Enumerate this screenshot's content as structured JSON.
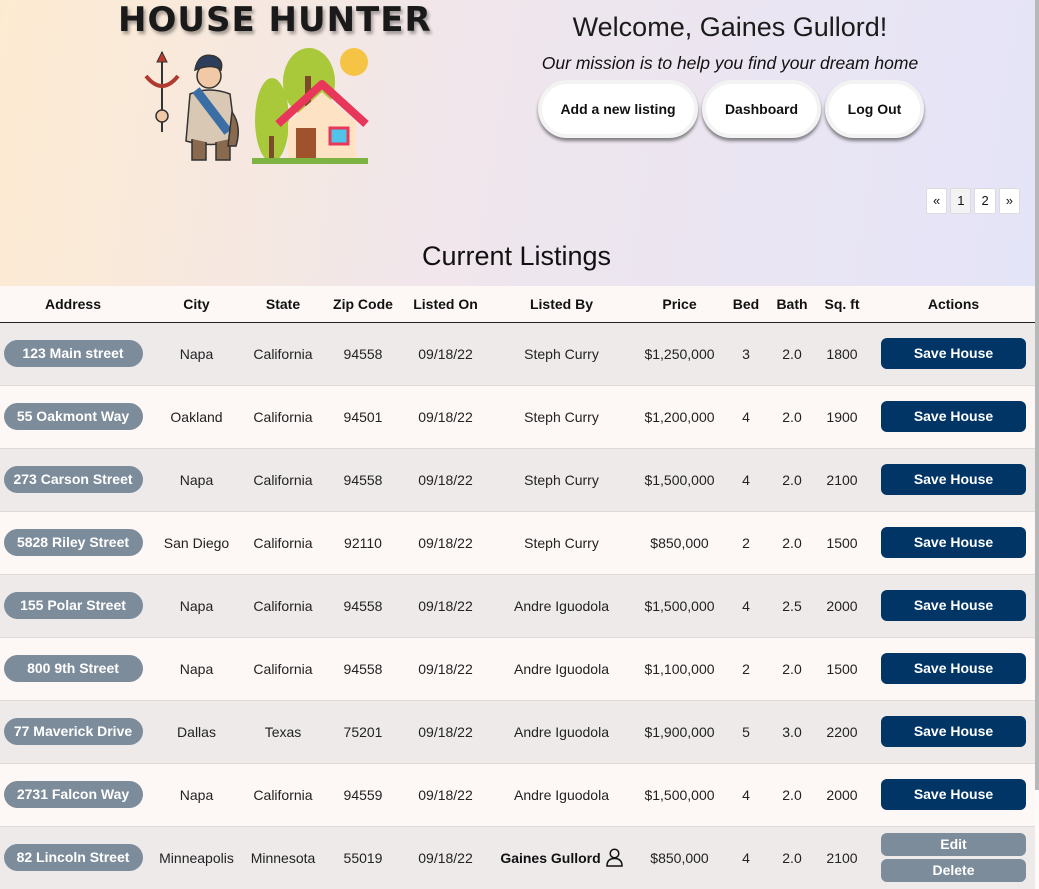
{
  "brand": {
    "title": "HOUSE HUNTER"
  },
  "header": {
    "welcome": "Welcome, Gaines Gullord!",
    "mission": "Our mission is to help you find your dream home",
    "add_listing_label": "Add a new listing",
    "dashboard_label": "Dashboard",
    "logout_label": "Log Out"
  },
  "pagination": {
    "prev": "«",
    "page1": "1",
    "page2": "2",
    "next": "»"
  },
  "listings": {
    "title": "Current Listings",
    "columns": [
      "Address",
      "City",
      "State",
      "Zip Code",
      "Listed On",
      "Listed By",
      "Price",
      "Bed",
      "Bath",
      "Sq. ft",
      "Actions"
    ],
    "save_label": "Save House",
    "edit_label": "Edit",
    "delete_label": "Delete",
    "rows": [
      {
        "address": "123 Main street",
        "city": "Napa",
        "state": "California",
        "zip": "94558",
        "listed_on": "09/18/22",
        "listed_by": "Steph Curry",
        "price": "$1,250,000",
        "bed": "3",
        "bath": "2.0",
        "sqft": "1800"
      },
      {
        "address": "55 Oakmont Way",
        "city": "Oakland",
        "state": "California",
        "zip": "94501",
        "listed_on": "09/18/22",
        "listed_by": "Steph Curry",
        "price": "$1,200,000",
        "bed": "4",
        "bath": "2.0",
        "sqft": "1900"
      },
      {
        "address": "273 Carson Street",
        "city": "Napa",
        "state": "California",
        "zip": "94558",
        "listed_on": "09/18/22",
        "listed_by": "Steph Curry",
        "price": "$1,500,000",
        "bed": "4",
        "bath": "2.0",
        "sqft": "2100"
      },
      {
        "address": "5828 Riley Street",
        "city": "San Diego",
        "state": "California",
        "zip": "92110",
        "listed_on": "09/18/22",
        "listed_by": "Steph Curry",
        "price": "$850,000",
        "bed": "2",
        "bath": "2.0",
        "sqft": "1500"
      },
      {
        "address": "155 Polar Street",
        "city": "Napa",
        "state": "California",
        "zip": "94558",
        "listed_on": "09/18/22",
        "listed_by": "Andre Iguodola",
        "price": "$1,500,000",
        "bed": "4",
        "bath": "2.5",
        "sqft": "2000"
      },
      {
        "address": "800 9th Street",
        "city": "Napa",
        "state": "California",
        "zip": "94558",
        "listed_on": "09/18/22",
        "listed_by": "Andre Iguodola",
        "price": "$1,100,000",
        "bed": "2",
        "bath": "2.0",
        "sqft": "1500"
      },
      {
        "address": "77 Maverick Drive",
        "city": "Dallas",
        "state": "Texas",
        "zip": "75201",
        "listed_on": "09/18/22",
        "listed_by": "Andre Iguodola",
        "price": "$1,900,000",
        "bed": "5",
        "bath": "3.0",
        "sqft": "2200"
      },
      {
        "address": "2731 Falcon Way",
        "city": "Napa",
        "state": "California",
        "zip": "94559",
        "listed_on": "09/18/22",
        "listed_by": "Andre Iguodola",
        "price": "$1,500,000",
        "bed": "4",
        "bath": "2.0",
        "sqft": "2000"
      },
      {
        "address": "82 Lincoln Street",
        "city": "Minneapolis",
        "state": "Minnesota",
        "zip": "55019",
        "listed_on": "09/18/22",
        "listed_by": "Gaines Gullord",
        "price": "$850,000",
        "bed": "4",
        "bath": "2.0",
        "sqft": "2100",
        "owned": true
      }
    ]
  },
  "icons": {
    "logo": "archer-and-house-illustration",
    "owner": "user-icon"
  },
  "colors": {
    "save_button": "#003566",
    "address_pill": "#7d8c9b",
    "edit_delete": "#7d8c9b"
  }
}
